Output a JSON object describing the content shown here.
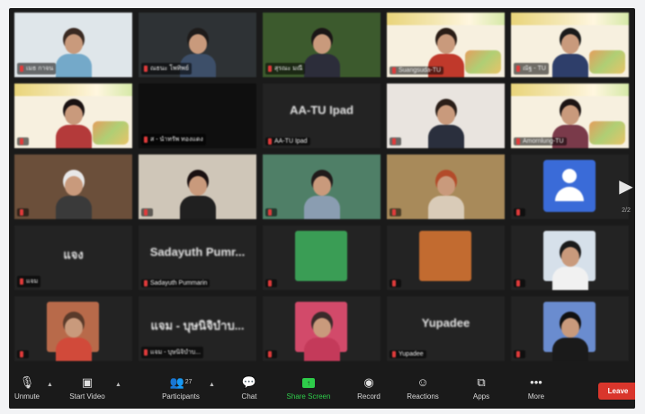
{
  "meeting": {
    "tiles": [
      {
        "name": "เมธ กาจน",
        "bg": "#dfe6ea",
        "hair": "#3a2a22",
        "shirt": "#74a9c9",
        "mic_muted": true,
        "slide": false
      },
      {
        "name": "ณธนะ โพทิพย์",
        "bg": "#2e3235",
        "hair": "#1e1b1a",
        "shirt": "#3d4f69",
        "mic_muted": true,
        "slide": false
      },
      {
        "name": "สุรณะ มณี",
        "bg": "#3c5a2d",
        "hair": "#1b1616",
        "shirt": "#2c2d3a",
        "mic_muted": true,
        "slide": false
      },
      {
        "name": "Suangsuda-TU",
        "bg": "#f7f0df",
        "hair": "#2a1d16",
        "shirt": "#c0392b",
        "mic_muted": true,
        "slide": true
      },
      {
        "name": "ณัฐ - TU",
        "bg": "#f7f0df",
        "hair": "#1a1a1a",
        "shirt": "#2e3e6a",
        "mic_muted": true,
        "slide": true
      },
      {
        "name": "",
        "bg": "#f7f0df",
        "hair": "#1a1212",
        "shirt": "#b43a3a",
        "mic_muted": true,
        "slide": true
      },
      {
        "name": "ส - นำทรัพ ทองแดง",
        "bg": "#0f0f0f",
        "hair": "",
        "shirt": "",
        "mic_muted": true,
        "slide": false
      },
      {
        "name": "AA-TU Ipad",
        "big_name": "AA-TU Ipad",
        "bg": "#232323",
        "mic_muted": true,
        "slide": false
      },
      {
        "name": "",
        "bg": "#e9e4df",
        "hair": "#2a1e18",
        "shirt": "#2a2f3d",
        "mic_muted": true,
        "slide": false
      },
      {
        "name": "Amornlung-TU",
        "bg": "#f7f0df",
        "hair": "#1c1414",
        "shirt": "#7a3a4a",
        "mic_muted": true,
        "slide": true
      },
      {
        "name": "",
        "bg": "#6b4f3a",
        "hair": "#e8e8e8",
        "shirt": "#3a3a3a",
        "mic_muted": true,
        "slide": false
      },
      {
        "name": "",
        "bg": "#cfc6b8",
        "hair": "#1a1010",
        "shirt": "#202020",
        "mic_muted": true,
        "slide": false
      },
      {
        "name": "",
        "bg": "#4f7f67",
        "hair": "#201a1a",
        "shirt": "#8a9db1",
        "mic_muted": true,
        "slide": false
      },
      {
        "name": "",
        "bg": "#a88a5a",
        "hair": "#b34b2a",
        "shirt": "#d9cbb8",
        "mic_muted": true,
        "slide": false
      },
      {
        "name": "",
        "avatar": true,
        "bg": "#232323",
        "mic_muted": true,
        "slide": false
      },
      {
        "name": "แจม",
        "big_name": "แจง",
        "bg": "#232323",
        "mic_muted": true,
        "slide": false
      },
      {
        "name": "Sadayuth Pummarin",
        "big_name": "Sadayuth Pumr...",
        "bg": "#232323",
        "mic_muted": true,
        "slide": false
      },
      {
        "name": "",
        "bg": "#232323",
        "inner": "#3a9d55",
        "mic_muted": true,
        "slide": false
      },
      {
        "name": "",
        "bg": "#232323",
        "inner": "#c26b30",
        "mic_muted": true,
        "slide": false
      },
      {
        "name": "",
        "bg": "#232323",
        "inner": "#d6e0ea",
        "hair": "#1a1a1a",
        "shirt": "#f1f1f1",
        "mic_muted": true,
        "slide": false
      },
      {
        "name": "",
        "bg": "#232323",
        "inner": "#b86a4a",
        "hair": "#5a3a2a",
        "shirt": "#d14a3a",
        "mic_muted": true,
        "slide": false
      },
      {
        "name": "แจม - บุษนิจิบำบ...",
        "big_name": "แจม - บุษนิจิบำบ...",
        "bg": "#232323",
        "mic_muted": true,
        "slide": false
      },
      {
        "name": "",
        "bg": "#232323",
        "inner": "#d24a6a",
        "hair": "#3a2a2a",
        "shirt": "#c43a5a",
        "mic_muted": true,
        "slide": false
      },
      {
        "name": "Yupadee",
        "big_name": "Yupadee",
        "bg": "#232323",
        "mic_muted": true,
        "slide": false
      },
      {
        "name": "",
        "bg": "#232323",
        "inner": "#6a8ccf",
        "hair": "#111111",
        "shirt": "#1a1a1a",
        "mic_muted": true,
        "slide": false
      }
    ],
    "page_indicator": "2/2",
    "next_arrow": "▶"
  },
  "toolbar": {
    "unmute": {
      "label": "Unmute",
      "icon": "mic-off-icon"
    },
    "video": {
      "label": "Start Video",
      "icon": "video-off-icon"
    },
    "participants": {
      "label": "Participants",
      "count": "27",
      "icon": "participants-icon"
    },
    "chat": {
      "label": "Chat",
      "icon": "chat-icon"
    },
    "share": {
      "label": "Share Screen",
      "icon": "share-screen-icon"
    },
    "record": {
      "label": "Record",
      "icon": "record-icon"
    },
    "reactions": {
      "label": "Reactions",
      "icon": "reactions-icon"
    },
    "apps": {
      "label": "Apps",
      "icon": "apps-icon"
    },
    "more": {
      "label": "More",
      "icon": "more-icon"
    },
    "leave": {
      "label": "Leave"
    }
  },
  "colors": {
    "leave": "#d9362c",
    "share": "#2ecc4a",
    "avatar": "#3a6bd8",
    "mic_muted": "#e23b3b"
  }
}
